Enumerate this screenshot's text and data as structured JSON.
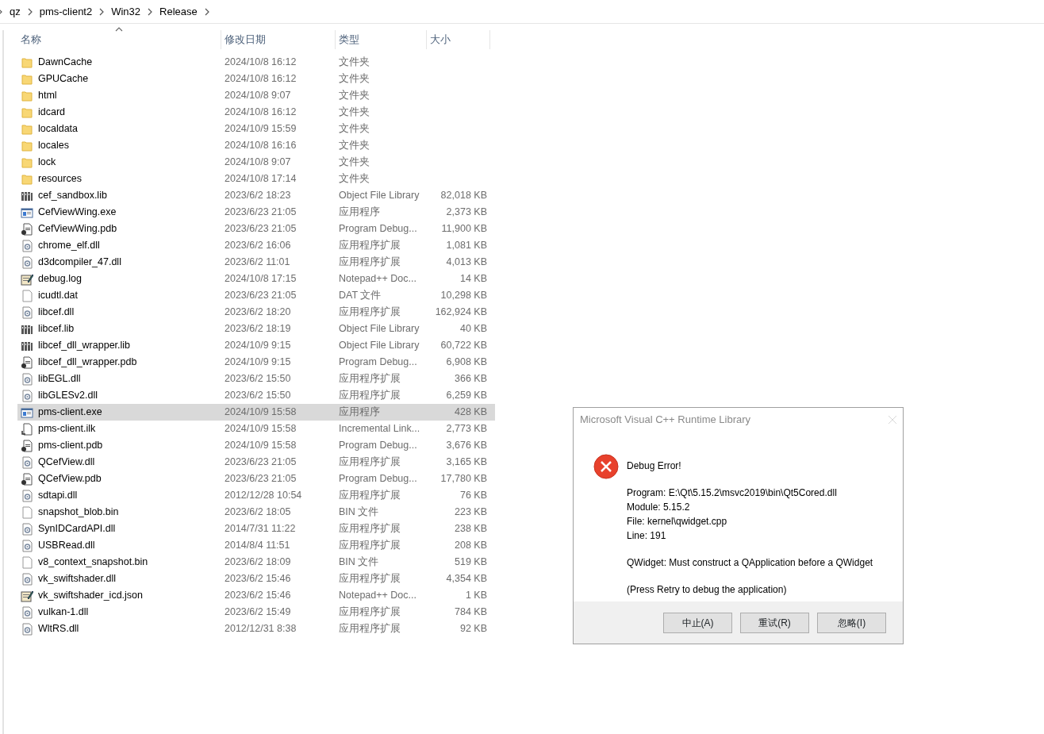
{
  "breadcrumb": [
    "qz",
    "pms-client2",
    "Win32",
    "Release"
  ],
  "columns": [
    {
      "label": "名称",
      "sorted": true
    },
    {
      "label": "修改日期",
      "sorted": false
    },
    {
      "label": "类型",
      "sorted": false
    },
    {
      "label": "大小",
      "sorted": false
    }
  ],
  "files": [
    {
      "name": "DawnCache",
      "date": "2024/10/8 16:12",
      "type": "文件夹",
      "kind": "folder",
      "selected": false
    },
    {
      "name": "GPUCache",
      "date": "2024/10/8 16:12",
      "type": "文件夹",
      "kind": "folder",
      "selected": false
    },
    {
      "name": "html",
      "date": "2024/10/8 9:07",
      "type": "文件夹",
      "kind": "folder",
      "selected": false
    },
    {
      "name": "idcard",
      "date": "2024/10/8 16:12",
      "type": "文件夹",
      "kind": "folder",
      "selected": false
    },
    {
      "name": "localdata",
      "date": "2024/10/9 15:59",
      "type": "文件夹",
      "kind": "folder",
      "selected": false
    },
    {
      "name": "locales",
      "date": "2024/10/8 16:16",
      "type": "文件夹",
      "kind": "folder",
      "selected": false
    },
    {
      "name": "lock",
      "date": "2024/10/8 9:07",
      "type": "文件夹",
      "kind": "folder",
      "selected": false
    },
    {
      "name": "resources",
      "date": "2024/10/8 17:14",
      "type": "文件夹",
      "kind": "folder",
      "selected": false
    },
    {
      "name": "cef_sandbox.lib",
      "date": "2023/6/2 18:23",
      "type": "Object File Library",
      "size": "82,018 KB",
      "kind": "lib",
      "selected": false
    },
    {
      "name": "CefViewWing.exe",
      "date": "2023/6/23 21:05",
      "type": "应用程序",
      "size": "2,373 KB",
      "kind": "exe",
      "selected": false
    },
    {
      "name": "CefViewWing.pdb",
      "date": "2023/6/23 21:05",
      "type": "Program Debug...",
      "size": "11,900 KB",
      "kind": "pdb",
      "selected": false
    },
    {
      "name": "chrome_elf.dll",
      "date": "2023/6/2 16:06",
      "type": "应用程序扩展",
      "size": "1,081 KB",
      "kind": "dll",
      "selected": false
    },
    {
      "name": "d3dcompiler_47.dll",
      "date": "2023/6/2 11:01",
      "type": "应用程序扩展",
      "size": "4,013 KB",
      "kind": "dll",
      "selected": false
    },
    {
      "name": "debug.log",
      "date": "2024/10/8 17:15",
      "type": "Notepad++ Doc...",
      "size": "14 KB",
      "kind": "notepad",
      "selected": false
    },
    {
      "name": "icudtl.dat",
      "date": "2023/6/23 21:05",
      "type": "DAT 文件",
      "size": "10,298 KB",
      "kind": "blank",
      "selected": false
    },
    {
      "name": "libcef.dll",
      "date": "2023/6/2 18:20",
      "type": "应用程序扩展",
      "size": "162,924 KB",
      "kind": "dll",
      "selected": false
    },
    {
      "name": "libcef.lib",
      "date": "2023/6/2 18:19",
      "type": "Object File Library",
      "size": "40 KB",
      "kind": "lib",
      "selected": false
    },
    {
      "name": "libcef_dll_wrapper.lib",
      "date": "2024/10/9 9:15",
      "type": "Object File Library",
      "size": "60,722 KB",
      "kind": "lib",
      "selected": false
    },
    {
      "name": "libcef_dll_wrapper.pdb",
      "date": "2024/10/9 9:15",
      "type": "Program Debug...",
      "size": "6,908 KB",
      "kind": "pdb",
      "selected": false
    },
    {
      "name": "libEGL.dll",
      "date": "2023/6/2 15:50",
      "type": "应用程序扩展",
      "size": "366 KB",
      "kind": "dll",
      "selected": false
    },
    {
      "name": "libGLESv2.dll",
      "date": "2023/6/2 15:50",
      "type": "应用程序扩展",
      "size": "6,259 KB",
      "kind": "dll",
      "selected": false
    },
    {
      "name": "pms-client.exe",
      "date": "2024/10/9 15:58",
      "type": "应用程序",
      "size": "428 KB",
      "kind": "exe",
      "selected": true
    },
    {
      "name": "pms-client.ilk",
      "date": "2024/10/9 15:58",
      "type": "Incremental Link...",
      "size": "2,773 KB",
      "kind": "ilk",
      "selected": false
    },
    {
      "name": "pms-client.pdb",
      "date": "2024/10/9 15:58",
      "type": "Program Debug...",
      "size": "3,676 KB",
      "kind": "pdb",
      "selected": false
    },
    {
      "name": "QCefView.dll",
      "date": "2023/6/23 21:05",
      "type": "应用程序扩展",
      "size": "3,165 KB",
      "kind": "dll",
      "selected": false
    },
    {
      "name": "QCefView.pdb",
      "date": "2023/6/23 21:05",
      "type": "Program Debug...",
      "size": "17,780 KB",
      "kind": "pdb",
      "selected": false
    },
    {
      "name": "sdtapi.dll",
      "date": "2012/12/28 10:54",
      "type": "应用程序扩展",
      "size": "76 KB",
      "kind": "dll",
      "selected": false
    },
    {
      "name": "snapshot_blob.bin",
      "date": "2023/6/2 18:05",
      "type": "BIN 文件",
      "size": "223 KB",
      "kind": "blank",
      "selected": false
    },
    {
      "name": "SynIDCardAPI.dll",
      "date": "2014/7/31 11:22",
      "type": "应用程序扩展",
      "size": "238 KB",
      "kind": "dll",
      "selected": false
    },
    {
      "name": "USBRead.dll",
      "date": "2014/8/4 11:51",
      "type": "应用程序扩展",
      "size": "208 KB",
      "kind": "dll",
      "selected": false
    },
    {
      "name": "v8_context_snapshot.bin",
      "date": "2023/6/2 18:09",
      "type": "BIN 文件",
      "size": "519 KB",
      "kind": "blank",
      "selected": false
    },
    {
      "name": "vk_swiftshader.dll",
      "date": "2023/6/2 15:46",
      "type": "应用程序扩展",
      "size": "4,354 KB",
      "kind": "dll",
      "selected": false
    },
    {
      "name": "vk_swiftshader_icd.json",
      "date": "2023/6/2 15:46",
      "type": "Notepad++ Doc...",
      "size": "1 KB",
      "kind": "notepad",
      "selected": false
    },
    {
      "name": "vulkan-1.dll",
      "date": "2023/6/2 15:49",
      "type": "应用程序扩展",
      "size": "784 KB",
      "kind": "dll",
      "selected": false
    },
    {
      "name": "WltRS.dll",
      "date": "2012/12/31 8:38",
      "type": "应用程序扩展",
      "size": "92 KB",
      "kind": "dll",
      "selected": false
    }
  ],
  "dialog": {
    "title": "Microsoft Visual C++ Runtime Library",
    "heading": "Debug Error!",
    "details": [
      "Program: E:\\Qt\\5.15.2\\msvc2019\\bin\\Qt5Cored.dll",
      "Module: 5.15.2",
      "File: kernel\\qwidget.cpp",
      "Line: 191"
    ],
    "message": "QWidget: Must construct a QApplication before a QWidget",
    "hint": "(Press Retry to debug the application)",
    "buttons": [
      "中止(A)",
      "重试(R)",
      "忽略(I)"
    ]
  }
}
